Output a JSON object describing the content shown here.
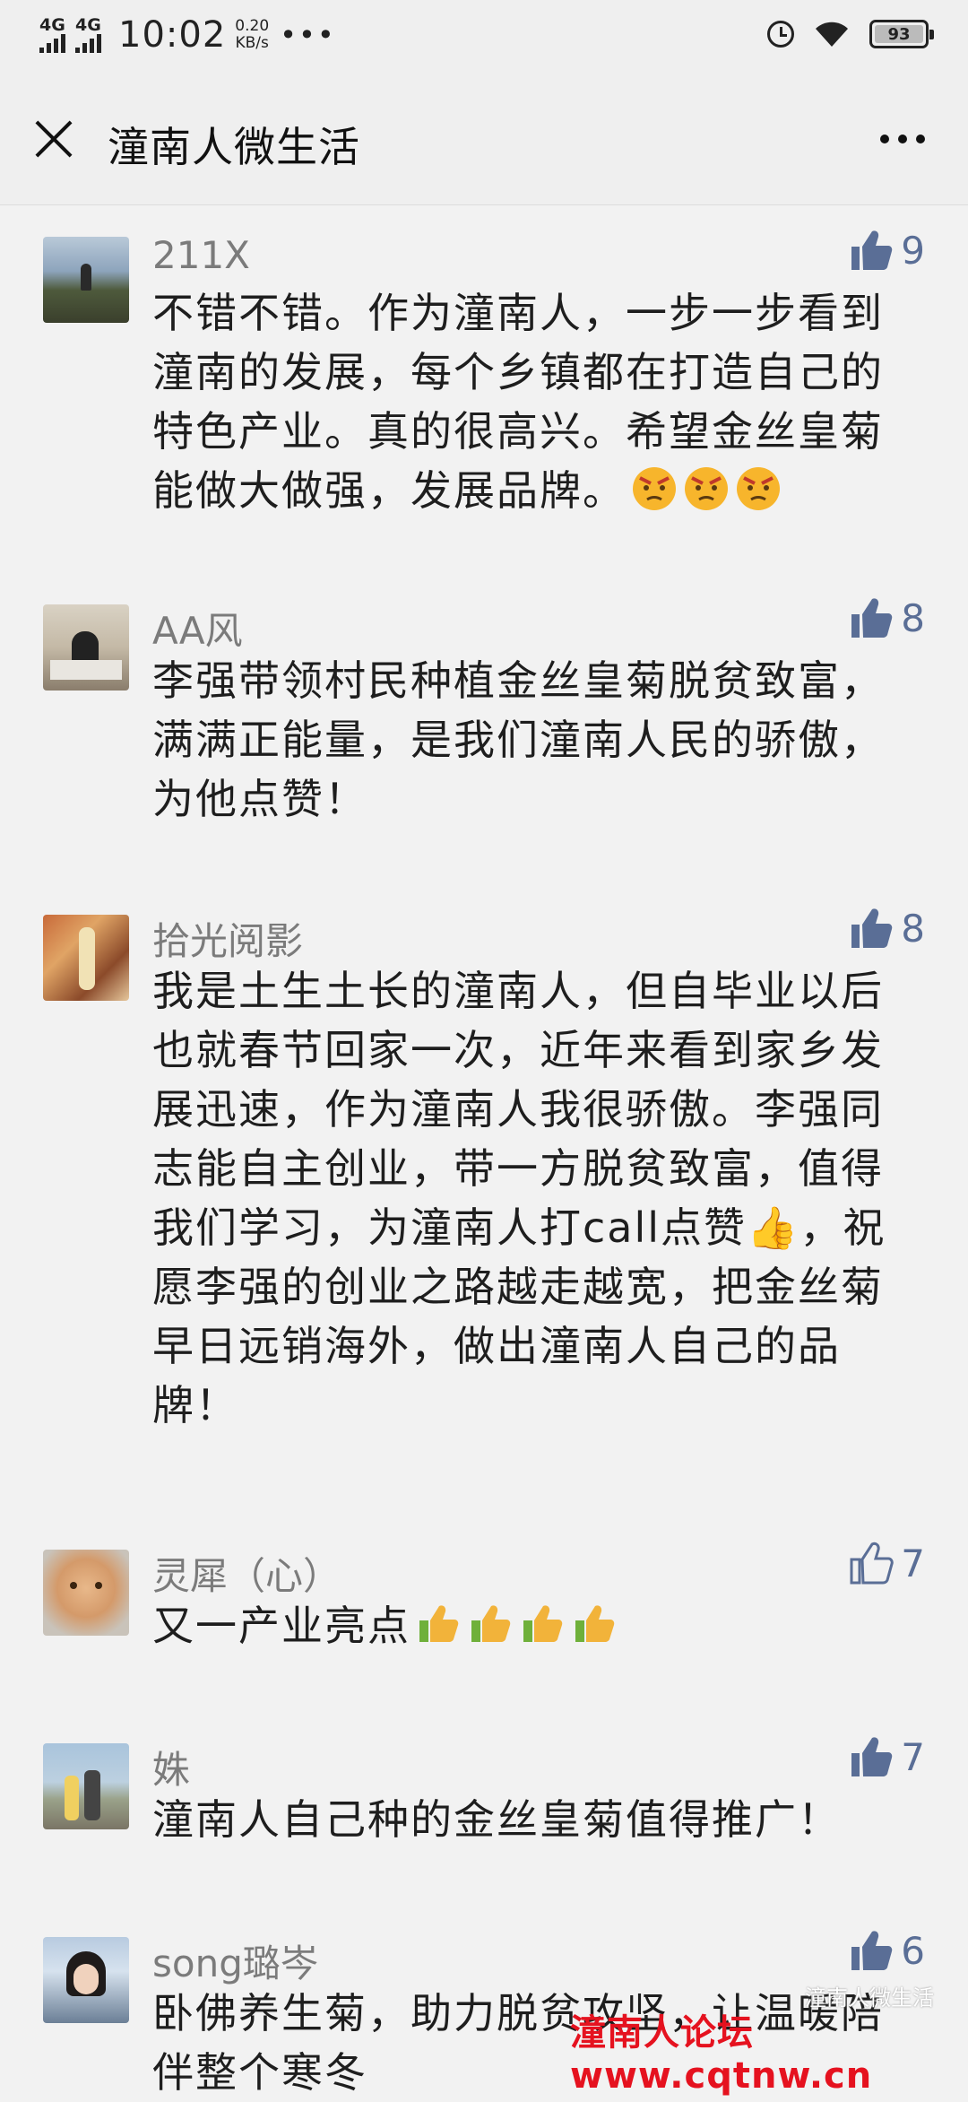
{
  "status_bar": {
    "network_1": "4G",
    "network_2": "4G",
    "time": "10:02",
    "speed_value": "0.20",
    "speed_unit": "KB/s",
    "more": "•••",
    "battery": "93",
    "icons": [
      "signal-icon",
      "alarm-icon",
      "wifi-icon",
      "battery-icon"
    ]
  },
  "header": {
    "title": "潼南人微生活",
    "close_icon": "close-icon",
    "more_icon": "more-icon"
  },
  "comments": [
    {
      "name": "211X",
      "likes": "9",
      "liked": true,
      "text": "不错不错。作为潼南人，一步一步看到潼南的发展，每个乡镇都在打造自己的特色产业。真的很高兴。希望金丝皇菊能做大做强，发展品牌。",
      "emojis": [
        "😤",
        "😤",
        "😤"
      ]
    },
    {
      "name": "AA风",
      "likes": "8",
      "liked": true,
      "text": "李强带领村民种植金丝皇菊脱贫致富，满满正能量，是我们潼南人民的骄傲，为他点赞！"
    },
    {
      "name": "拾光阅影",
      "likes": "8",
      "liked": true,
      "text_before": "我是土生土长的潼南人，但自毕业以后也就春节回家一次，近年来看到家乡发展迅速，作为潼南人我很骄傲。李强同志能自主创业，带一方脱贫致富，值得我们学习，为潼南人打call点赞",
      "emoji": "👍",
      "text_after": "，祝愿李强的创业之路越走越宽，把金丝菊早日远销海外，做出潼南人自己的品牌！"
    },
    {
      "name": "灵犀（心）",
      "likes": "7",
      "liked": false,
      "text": "又一产业亮点",
      "emojis": [
        "👍",
        "👍",
        "👍",
        "👍"
      ]
    },
    {
      "name": "姝",
      "likes": "7",
      "liked": true,
      "text": "潼南人自己种的金丝皇菊值得推广！"
    },
    {
      "name": "song璐岑",
      "likes": "6",
      "liked": true,
      "text": "卧佛养生菊，助力脱贫攻坚，让温暖陪伴整个寒冬"
    }
  ],
  "watermark": "潼南人微生活",
  "forum_mark": "潼南人论坛www.cqtnw.cn",
  "colors": {
    "accent": "#5a6e96",
    "forum_red": "#e5121f",
    "background": "#f2f2f2"
  }
}
